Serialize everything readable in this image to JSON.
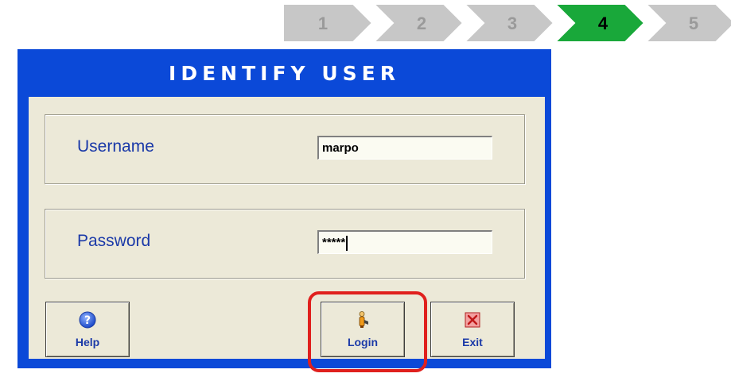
{
  "steps": {
    "items": [
      {
        "label": "1",
        "state": "inactive"
      },
      {
        "label": "2",
        "state": "inactive"
      },
      {
        "label": "3",
        "state": "inactive"
      },
      {
        "label": "4",
        "state": "active"
      },
      {
        "label": "5",
        "state": "inactive"
      }
    ],
    "colors": {
      "inactive_fill": "#c7c7c7",
      "inactive_text": "#9a9a9a",
      "active_fill": "#19a83a",
      "active_text": "#000000"
    }
  },
  "dialog": {
    "title": "IDENTIFY USER",
    "title_bar_color": "#0b49d8",
    "username": {
      "label": "Username",
      "value": "marpo"
    },
    "password": {
      "label": "Password",
      "value": "*****"
    },
    "buttons": {
      "help": {
        "label": "Help",
        "icon": "help-icon"
      },
      "login": {
        "label": "Login",
        "icon": "user-icon"
      },
      "exit": {
        "label": "Exit",
        "icon": "close-icon"
      }
    },
    "highlight_color": "#e0201d"
  }
}
